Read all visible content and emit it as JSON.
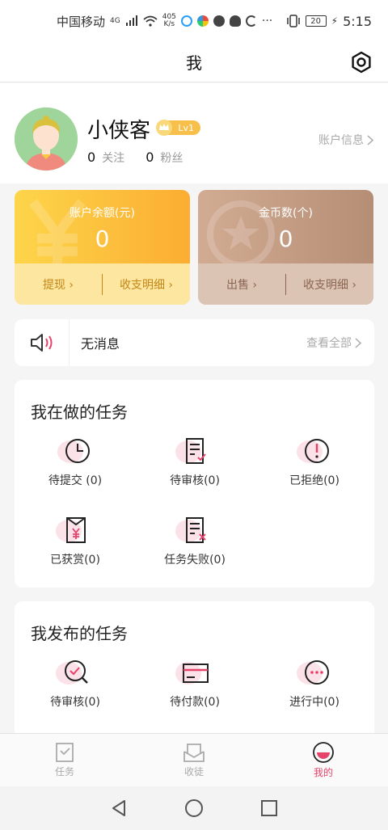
{
  "statusbar": {
    "carrier": "中国移动",
    "net_badge": "4G",
    "speed_top": "405",
    "speed_bottom": "K/s",
    "battery": "20",
    "time": "5:15"
  },
  "header": {
    "title": "我",
    "settings_icon": "gear-icon"
  },
  "profile": {
    "username": "小侠客",
    "level": "Lv1",
    "following_count": "0",
    "following_label": "关注",
    "fans_count": "0",
    "fans_label": "粉丝",
    "account_info": "账户信息"
  },
  "wallet": {
    "balance": {
      "title": "账户余额(元)",
      "value": "0",
      "action1": "提现",
      "action2": "收支明细"
    },
    "coins": {
      "title": "金币数(个)",
      "value": "0",
      "action1": "出售",
      "action2": "收支明细"
    }
  },
  "notice": {
    "message": "无消息",
    "view_all": "查看全部"
  },
  "my_tasks": {
    "title": "我在做的任务",
    "items": [
      {
        "label": "待提交 (0)",
        "icon": "clock-icon"
      },
      {
        "label": "待审核(0)",
        "icon": "document-check-icon"
      },
      {
        "label": "已拒绝(0)",
        "icon": "exclamation-circle-icon"
      },
      {
        "label": "已获赏(0)",
        "icon": "yuan-reward-icon"
      },
      {
        "label": "任务失败(0)",
        "icon": "document-x-icon"
      }
    ]
  },
  "published_tasks": {
    "title": "我发布的任务",
    "items": [
      {
        "label": "待审核(0)",
        "icon": "search-check-icon"
      },
      {
        "label": "待付款(0)",
        "icon": "credit-card-icon"
      },
      {
        "label": "进行中(0)",
        "icon": "more-circle-icon"
      }
    ]
  },
  "bottom_nav": [
    {
      "label": "任务",
      "icon": "task-icon",
      "active": false
    },
    {
      "label": "收徒",
      "icon": "inbox-icon",
      "active": false
    },
    {
      "label": "我的",
      "icon": "profile-icon",
      "active": true
    }
  ],
  "colors": {
    "accent": "#e6436b",
    "gold": "#fbad32",
    "brown": "#b58e75"
  }
}
